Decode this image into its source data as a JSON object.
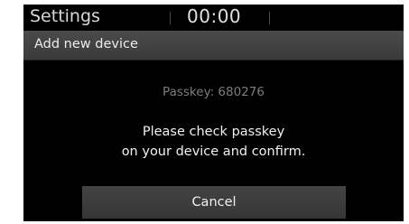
{
  "status_bar": {
    "title": "Settings",
    "clock": "00:00"
  },
  "header": {
    "title": "Add new device"
  },
  "dialog": {
    "passkey": "Passkey: 680276",
    "message_line1": "Please check passkey",
    "message_line2": "on your device and confirm.",
    "cancel_label": "Cancel"
  },
  "colors": {
    "background": "#000000",
    "header_bar": "#3a3a3a",
    "button": "#3c3c3c",
    "passkey_text": "#7d7d7d",
    "primary_text": "#f0f0f0"
  }
}
